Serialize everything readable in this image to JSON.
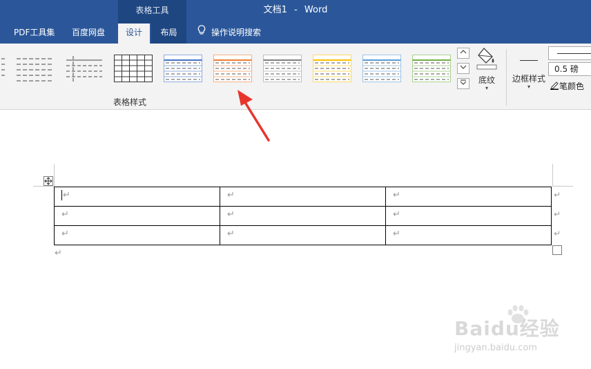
{
  "window": {
    "context_group": "表格工具",
    "document_name": "文档1",
    "separator": "-",
    "app_name": "Word"
  },
  "tabs": [
    {
      "label": "PDF工具集"
    },
    {
      "label": "百度网盘"
    },
    {
      "label": "设计",
      "active": true
    },
    {
      "label": "布局"
    },
    {
      "label": "操作说明搜索",
      "icon": "lightbulb-icon"
    }
  ],
  "ribbon": {
    "table_styles_group_label": "表格样式",
    "table_style_thumbnails": [
      {
        "accent": "#444444",
        "variant": "plain"
      },
      {
        "accent": "#444444",
        "variant": "plain-grid"
      },
      {
        "accent": "#444444",
        "variant": "grid"
      },
      {
        "accent": "#4472c4",
        "variant": "grid"
      },
      {
        "accent": "#ed7d31",
        "variant": "grid"
      },
      {
        "accent": "#7f7f7f",
        "variant": "grid"
      },
      {
        "accent": "#ffc000",
        "variant": "grid"
      },
      {
        "accent": "#5b9bd5",
        "variant": "grid"
      },
      {
        "accent": "#70ad47",
        "variant": "grid"
      }
    ],
    "gallery_up_icon": "chevron-up-icon",
    "gallery_down_icon": "chevron-down-icon",
    "gallery_more_icon": "more-icon",
    "shading_label": "底纹",
    "border_styles_label": "边框样式",
    "line_weight": "0.5 磅",
    "pen_color_label": "笔颜色"
  },
  "document": {
    "table": {
      "rows": 3,
      "cols": 3,
      "cell_mark": "↵"
    },
    "end_of_row_mark": "↵",
    "paragraph_mark": "↵",
    "move_handle_icon": "move-cross-icon"
  },
  "annotation": {
    "arrow_color": "#e8352c"
  },
  "watermark": {
    "brand": "Baidu经验",
    "url": "jingyan.baidu.com"
  }
}
